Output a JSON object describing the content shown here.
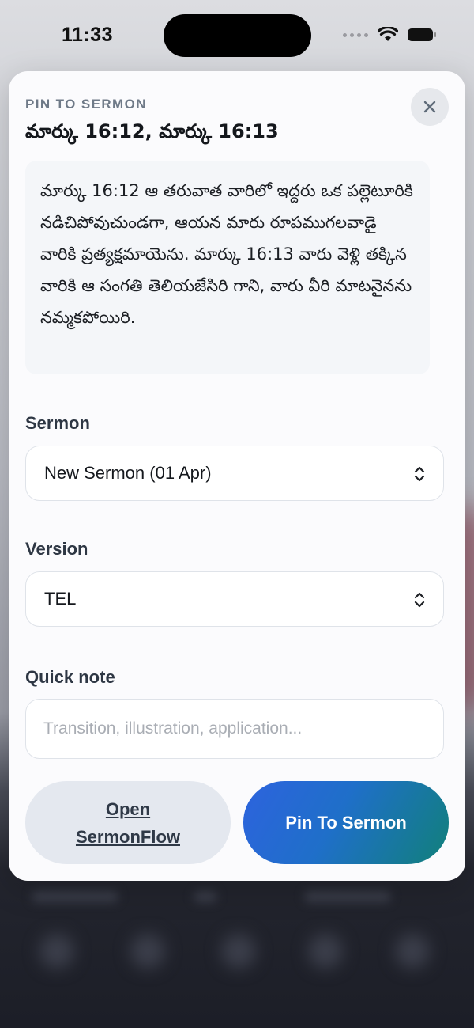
{
  "status_bar": {
    "time": "11:33"
  },
  "sheet": {
    "eyebrow": "PIN TO SERMON",
    "title": "మార్కు 16:12, మార్కు 16:13",
    "close_icon": "close-icon",
    "verse_text": "మార్కు 16:12 ఆ తరువాత వారిలో ఇద్దరు ఒక పల్లెటూరికి నడిచిపోవుచుండగా, ఆయన మారు రూపముగలవాడై వారికి ప్రత్యక్షమాయెను. మార్కు 16:13 వారు వెళ్లి తక్కిన వారికి ఆ సంగతి తెలియజేసిరి గాని, వారు వీరి మాటనైనను నమ్మకపోయిరి."
  },
  "sermon": {
    "label": "Sermon",
    "value": "New Sermon (01 Apr)",
    "icon": "chevron-updown-icon"
  },
  "version": {
    "label": "Version",
    "value": "TEL",
    "icon": "chevron-updown-icon"
  },
  "note": {
    "label": "Quick note",
    "value": "",
    "placeholder": "Transition, illustration, application..."
  },
  "actions": {
    "secondary_label": "Open SermonFlow",
    "primary_label": "Pin To Sermon"
  },
  "colors": {
    "accent_start": "#2d63de",
    "accent_end": "#11807a",
    "sheet_background": "#fbfbfd",
    "label_text": "#2e3744"
  }
}
